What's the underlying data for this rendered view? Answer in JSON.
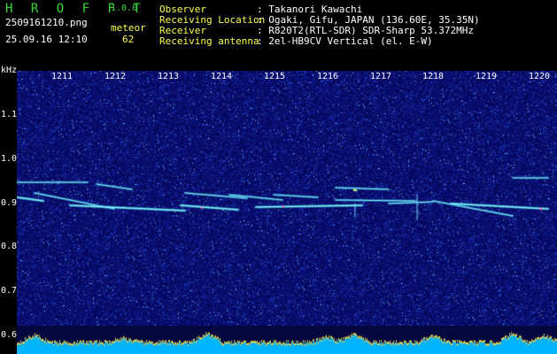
{
  "header": {
    "app_title": "H R O F F T",
    "version": "1.0.0",
    "filename": "2509161210.png",
    "meteor_label": "meteor",
    "datetime": "25.09.16 12:10",
    "meteor_count": "62",
    "info": [
      {
        "label": "Observer",
        "value": ": Takanori Kawachi"
      },
      {
        "label": "Receiving Location",
        "value": ": Ogaki, Gifu, JAPAN (136.60E, 35.35N)"
      },
      {
        "label": "Receiver",
        "value": ": R820T2(RTL-SDR) SDR-Sharp 53.372MHz"
      },
      {
        "label": "Receiving antenna",
        "value": ": 2el-HB9CV Vertical (el. E-W)"
      }
    ]
  },
  "axis": {
    "unit": "kHz",
    "y_labels": [
      "1.1",
      "1.0",
      "0.9",
      "0.8",
      "0.7",
      "0.6"
    ],
    "x_labels": [
      "1211",
      "1212",
      "1213",
      "1214",
      "1215",
      "1216",
      "1217",
      "1218",
      "1219",
      "1220"
    ]
  },
  "colors": {
    "background": "#06085a",
    "trail_core": "#80ffe6",
    "trail_glow": "#3aa8ff",
    "meter": "#00b4ff",
    "meter_peak": "#ffe84a",
    "header_green": "#35d935"
  }
}
